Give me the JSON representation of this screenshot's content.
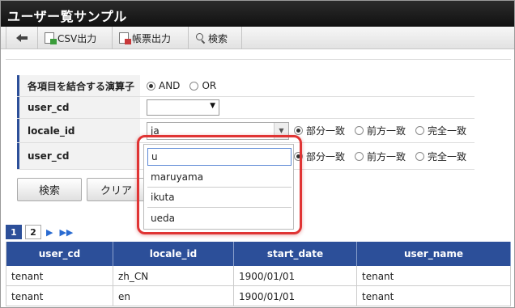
{
  "app": {
    "title": "ユーザー覧サンプル"
  },
  "toolbar": {
    "back_icon": "back-arrow-icon",
    "csv_label": "CSV出力",
    "ledger_label": "帳票出力",
    "search_label": "検索"
  },
  "form": {
    "operator": {
      "label": "各項目を結合する演算子",
      "options": [
        "AND",
        "OR"
      ],
      "selected": "AND"
    },
    "user_cd_1": {
      "label": "user_cd",
      "value": ""
    },
    "locale_id": {
      "label": "locale_id",
      "value": "ja",
      "match_options": [
        "部分一致",
        "前方一致",
        "完全一致"
      ],
      "match_selected": "部分一致"
    },
    "user_cd_2": {
      "label": "user_cd",
      "value": "u",
      "match_options": [
        "部分一致",
        "前方一致",
        "完全一致"
      ],
      "match_selected": "部分一致"
    }
  },
  "buttons": {
    "search": "検索",
    "clear": "クリア"
  },
  "autocomplete": {
    "input_value": "u",
    "suggestions": [
      "maruyama",
      "ikuta",
      "ueda"
    ]
  },
  "pager": {
    "pages": [
      "1",
      "2"
    ],
    "current": "1",
    "next_icon": "next-icon",
    "last_icon": "last-icon"
  },
  "grid": {
    "columns": [
      "user_cd",
      "locale_id",
      "start_date",
      "user_name"
    ],
    "rows": [
      [
        "tenant",
        "zh_CN",
        "1900/01/01",
        "tenant"
      ],
      [
        "tenant",
        "en",
        "1900/01/01",
        "tenant"
      ]
    ]
  },
  "colors": {
    "header_blue": "#2c4f99",
    "highlight_red": "#e03434",
    "titlebar": "#1a1a1a"
  }
}
